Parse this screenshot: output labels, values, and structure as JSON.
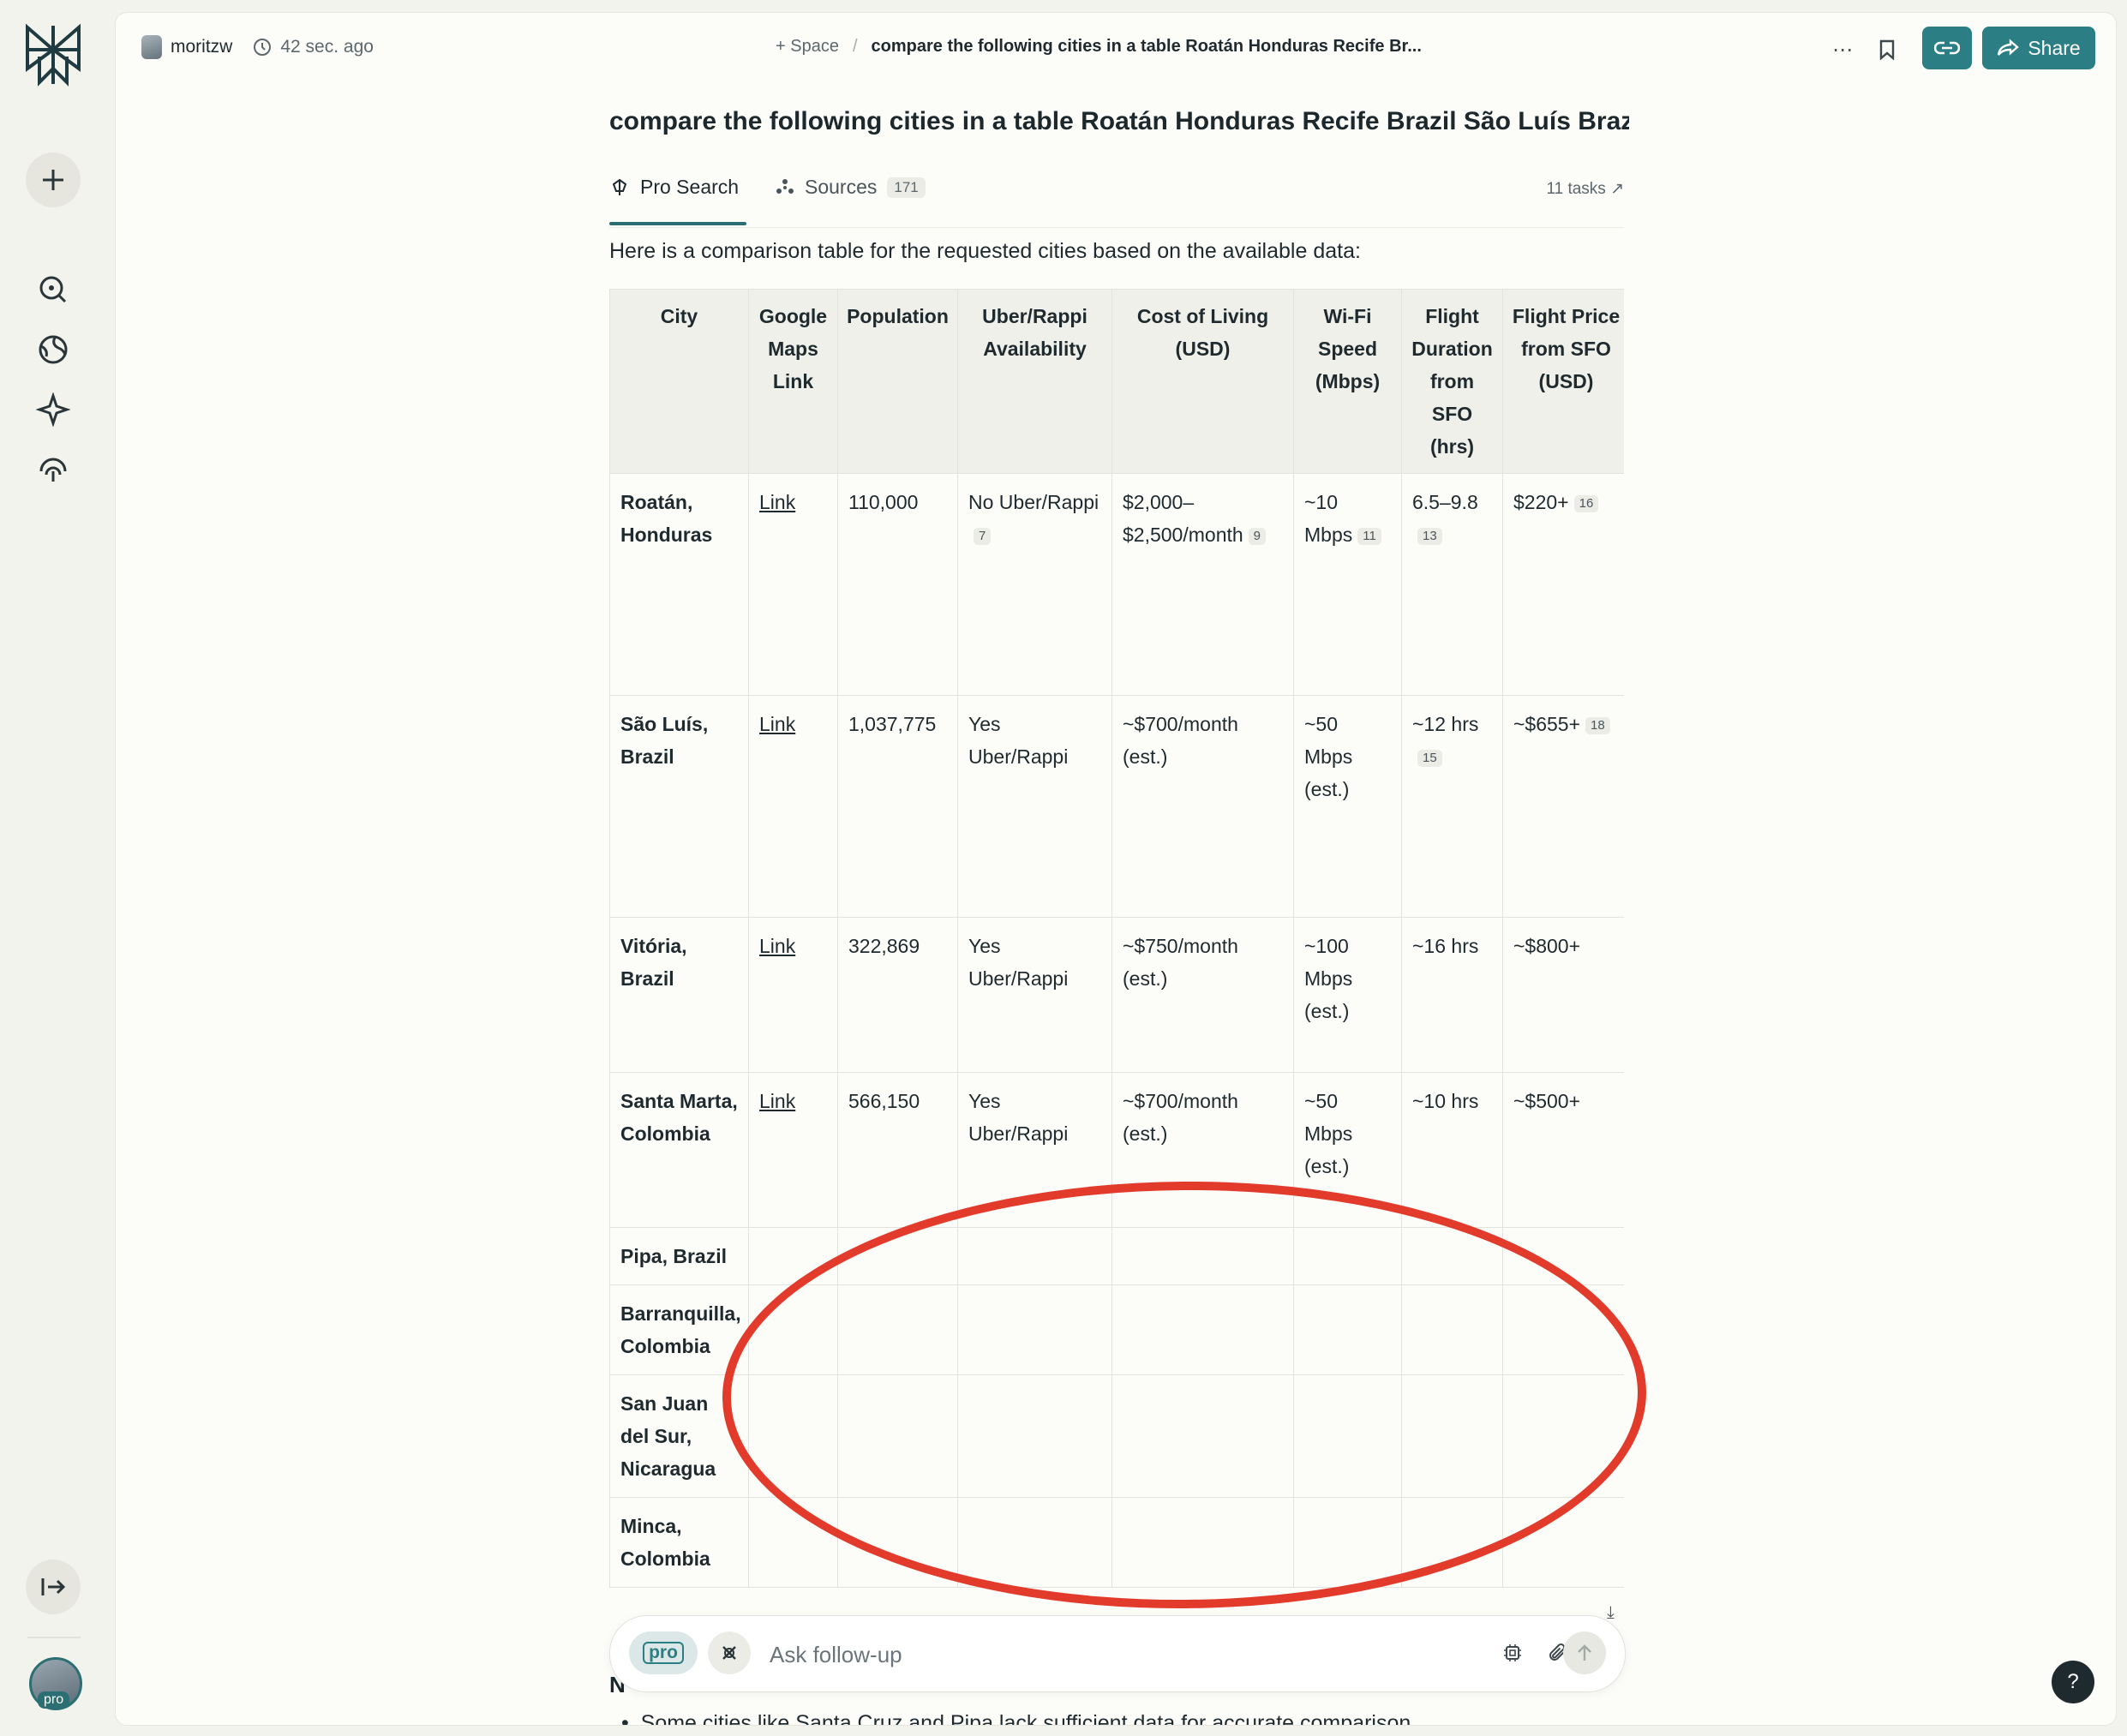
{
  "header": {
    "user_name": "moritzw",
    "time_ago": "42 sec. ago",
    "space_label": "+ Space",
    "crumb_sep": "/",
    "thread_title_short": "compare the following cities in a table Roatán Honduras Recife Br...",
    "share_label": "Share"
  },
  "thread": {
    "title": "compare the following cities in a table Roatán Honduras Recife Brazil São Luís Brazi...",
    "tabs": [
      {
        "label": "Pro Search"
      },
      {
        "label": "Sources",
        "count": "171"
      }
    ],
    "tasks": "11 tasks ↗",
    "intro": "Here is a comparison table for the requested cities based on the available data:"
  },
  "table": {
    "headers": [
      "City",
      "Google Maps Link",
      "Population",
      "Uber/Rappi Availability",
      "Cost of Living (USD)",
      "Wi-Fi Speed (Mbps)",
      "Flight Duration from SFO (hrs)",
      "Flight Price from SFO (USD)"
    ],
    "rows": [
      {
        "city": "Roatán, Honduras",
        "link": "Link",
        "population": "110,000",
        "uber": "No Uber/Rappi",
        "uber_cite": "7",
        "cost": "$2,000–$2,500/month",
        "cost_cite": "9",
        "wifi": "~10 Mbps",
        "wifi_cite": "11",
        "flight_dur": "6.5–9.8",
        "flight_dur_cite": "13",
        "price": "$220+",
        "price_cite": "16"
      },
      {
        "city": "São Luís, Brazil",
        "link": "Link",
        "population": "1,037,775",
        "uber": "Yes Uber/Rappi",
        "uber_cite": "",
        "cost": "~$700/month (est.)",
        "cost_cite": "",
        "wifi": "~50 Mbps (est.)",
        "wifi_cite": "",
        "flight_dur": "~12 hrs",
        "flight_dur_cite": "15",
        "price": "~$655+",
        "price_cite": "18"
      },
      {
        "city": "Vitória, Brazil",
        "link": "Link",
        "population": "322,869",
        "uber": "Yes Uber/Rappi",
        "uber_cite": "",
        "cost": "~$750/month (est.)",
        "cost_cite": "",
        "wifi": "~100 Mbps (est.)",
        "wifi_cite": "",
        "flight_dur": "~16 hrs",
        "flight_dur_cite": "",
        "price": "~$800+",
        "price_cite": ""
      },
      {
        "city": "Santa Marta, Colombia",
        "link": "Link",
        "population": "566,150",
        "uber": "Yes Uber/Rappi",
        "uber_cite": "",
        "cost": "~$700/month (est.)",
        "cost_cite": "",
        "wifi": "~50 Mbps (est.)",
        "wifi_cite": "",
        "flight_dur": "~10 hrs",
        "flight_dur_cite": "",
        "price": "~$500+",
        "price_cite": ""
      },
      {
        "city": "Pipa, Brazil"
      },
      {
        "city": "Barranquilla, Colombia"
      },
      {
        "city": "San Juan del Sur, Nicaragua"
      },
      {
        "city": "Minca, Colombia"
      }
    ]
  },
  "followup": {
    "pro_label": "pro",
    "placeholder": "Ask follow-up"
  },
  "below": {
    "heading_start": "N",
    "bullet": "Some cities like Santa Cruz and Pipa lack sufficient data for accurate comparison."
  },
  "rail": {
    "pro_badge": "pro"
  },
  "help": "?",
  "colors": {
    "accent": "#2b7e83",
    "annotation": "#e23b2c",
    "background": "#fcfcf9"
  }
}
